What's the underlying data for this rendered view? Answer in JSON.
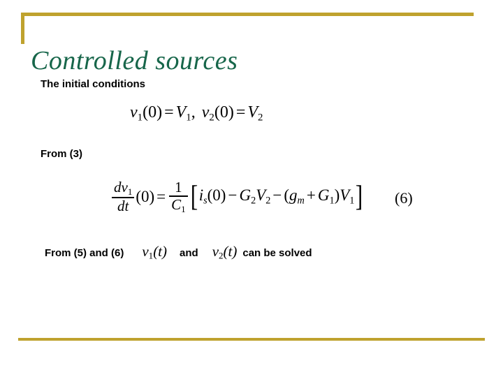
{
  "slide": {
    "title": "Controlled sources",
    "title_color": "#17664A",
    "accent_color": "#BFA22E",
    "background_color": "#FFFFFF"
  },
  "body": {
    "initial_conditions_label": "The initial conditions",
    "from_3_label": "From (3)",
    "from_5_and_6_label": "From (5) and (6)",
    "and_label": "and",
    "can_be_solved_label": "can be solved"
  },
  "equations": {
    "initial_conditions": {
      "v1_name": "v",
      "v1_sub": "1",
      "v1_arg": "(0)",
      "equals": "=",
      "V1_name": "V",
      "V1_sub": "1",
      "comma": ",",
      "v2_name": "v",
      "v2_sub": "2",
      "v2_arg": "(0)",
      "equals2": "=",
      "V2_name": "V",
      "V2_sub": "2",
      "plain_text": "v1(0) = V1,  v2(0) = V2"
    },
    "equation_6": {
      "label": "(6)",
      "deriv_num_d": "d",
      "deriv_num_v": "v",
      "deriv_num_sub": "1",
      "deriv_den": "dt",
      "deriv_arg": "(0)",
      "equals": "=",
      "frac_num": "1",
      "frac_den_C": "C",
      "frac_den_sub": "1",
      "bracket_open": "[",
      "is_name": "i",
      "is_sub": "s",
      "is_arg": "(0)",
      "minus1": "−",
      "G2_name": "G",
      "G2_sub": "2",
      "V2_name": "V",
      "V2_sub": "2",
      "minus2": "−",
      "paren_open": "(",
      "gm_name": "g",
      "gm_sub": "m",
      "plus": "+",
      "G1_name": "G",
      "G1_sub": "1",
      "paren_close": ")",
      "V1_name": "V",
      "V1_sub": "1",
      "bracket_close": "]",
      "plain_text": "dv1/dt (0) = 1/C1 [ is(0) - G2V2 - (gm + G1)V1 ]"
    },
    "inline_v1_t": {
      "name": "v",
      "sub": "1",
      "arg": "(t)",
      "plain_text": "v1(t)"
    },
    "inline_v2_t": {
      "name": "v",
      "sub": "2",
      "arg": "(t)",
      "plain_text": "v2(t)"
    }
  }
}
